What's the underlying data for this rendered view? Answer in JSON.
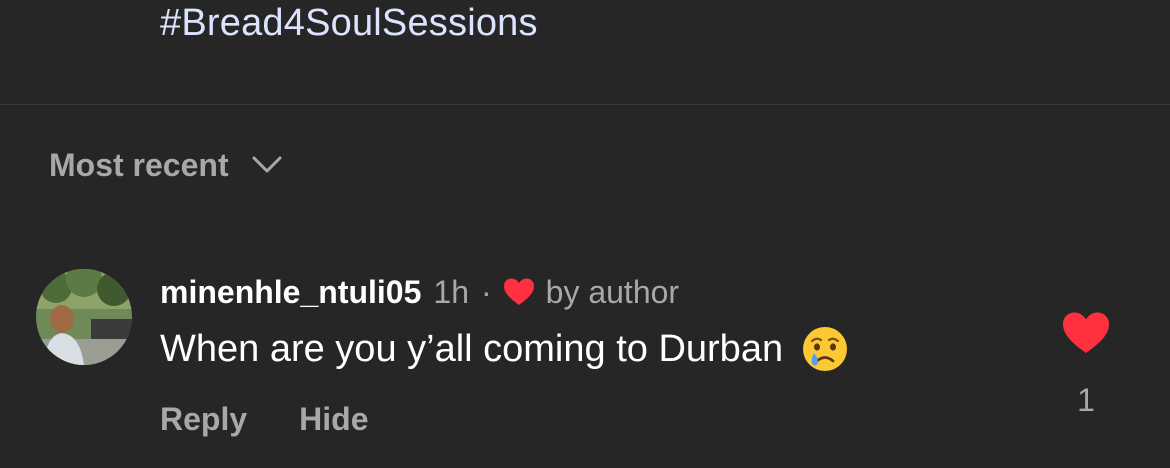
{
  "caption": {
    "hashtag": "#Bread4SoulSessions"
  },
  "sort": {
    "label": "Most recent",
    "icon": "chevron-down-icon"
  },
  "comment": {
    "username": "minenhle_ntuli05",
    "time": "1h",
    "separator": "·",
    "liked_by_author_label": "by author",
    "text": "When are you y’all coming to Durban",
    "emoji": "crying-face-emoji",
    "actions": {
      "reply": "Reply",
      "hide": "Hide"
    },
    "like": {
      "icon": "heart-icon",
      "liked": true,
      "count": "1"
    }
  },
  "colors": {
    "background": "#262626",
    "hashtag": "#dbe4ff",
    "secondary_text": "#a8a8a8",
    "primary_text": "#ffffff",
    "heart": "#ff3040",
    "divider": "#3a3a3a"
  }
}
